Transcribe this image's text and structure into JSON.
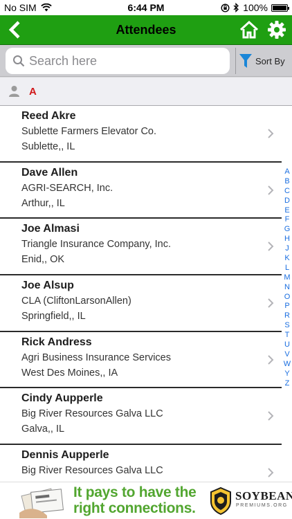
{
  "status_bar": {
    "carrier": "No SIM",
    "time": "6:44 PM",
    "battery": "100%",
    "battery_level": 1.0,
    "icons": [
      "wifi-icon",
      "orientation-lock-icon",
      "bluetooth-icon",
      "battery-icon"
    ]
  },
  "header": {
    "title": "Attendees",
    "icons": [
      "back-arrow-icon",
      "home-icon",
      "gear-icon"
    ]
  },
  "search": {
    "placeholder": "Search here",
    "value": ""
  },
  "sort": {
    "label": "Sort By"
  },
  "section": {
    "letter": "A"
  },
  "attendees": [
    {
      "name": "Reed Akre",
      "company": "Sublette Farmers Elevator Co.",
      "location": "Sublette,, IL"
    },
    {
      "name": "Dave Allen",
      "company": "AGRI-SEARCH, Inc.",
      "location": "Arthur,, IL"
    },
    {
      "name": "Joe Almasi",
      "company": "Triangle Insurance Company, Inc.",
      "location": "Enid,, OK"
    },
    {
      "name": "Joe Alsup",
      "company": "CLA (CliftonLarsonAllen)",
      "location": "Springfield,, IL"
    },
    {
      "name": "Rick Andress",
      "company": "Agri Business Insurance Services",
      "location": "West Des Moines,, IA"
    },
    {
      "name": "Cindy Aupperle",
      "company": "Big River Resources Galva LLC",
      "location": "Galva,, IL"
    },
    {
      "name": "Dennis Aupperle",
      "company": "Big River Resources Galva LLC",
      "location": ""
    }
  ],
  "index_letters": [
    "A",
    "B",
    "C",
    "D",
    "E",
    "F",
    "G",
    "H",
    "J",
    "K",
    "L",
    "M",
    "N",
    "O",
    "P",
    "R",
    "S",
    "T",
    "U",
    "V",
    "W",
    "Y",
    "Z"
  ],
  "banner": {
    "line1": "It pays to have the",
    "line2": "right connections.",
    "brand": "SOYBEAN",
    "sub": "PREMIUMS.ORG",
    "accent": "#52a630"
  },
  "colors": {
    "header_green": "#1f9f12",
    "section_letter": "#d1181a",
    "index_blue": "#1a6ee0"
  }
}
